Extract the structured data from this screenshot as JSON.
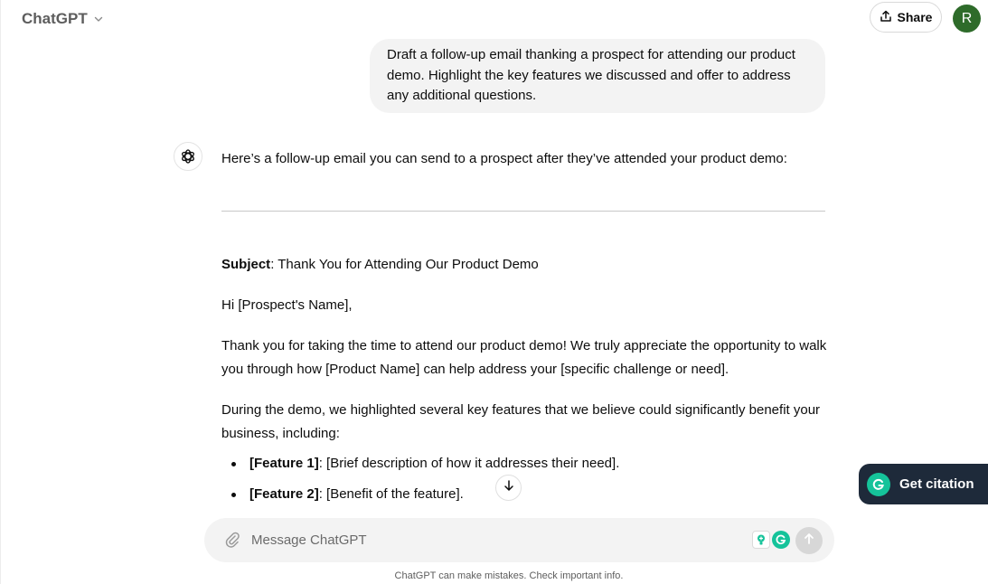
{
  "header": {
    "model_name": "ChatGPT",
    "share_label": "Share",
    "avatar_initial": "R"
  },
  "conversation": {
    "user_message": "Draft a follow-up email thanking a prospect for attending our product demo. Highlight the key features we discussed and offer to address any additional questions.",
    "assistant_intro": "Here’s a follow-up email you can send to a prospect after they’ve attended your product demo:",
    "subject_label": "Subject",
    "subject_text": ": Thank You for Attending Our Product Demo",
    "greeting": "Hi [Prospect's Name],",
    "paragraph_1": "Thank you for taking the time to attend our product demo! We truly appreciate the opportunity to walk you through how [Product Name] can help address your [specific challenge or need].",
    "paragraph_2": "During the demo, we highlighted several key features that we believe could significantly benefit your business, including:",
    "features": [
      {
        "name": "[Feature 1]",
        "desc": ": [Brief description of how it addresses their need]."
      },
      {
        "name": "[Feature 2]",
        "desc": ": [Benefit of the feature]."
      }
    ]
  },
  "grammarly": {
    "citation_label": "Get citation",
    "brand_color": "#15c39a"
  },
  "composer": {
    "placeholder": "Message ChatGPT"
  },
  "footer": {
    "disclaimer": "ChatGPT can make mistakes. Check important info."
  },
  "icons": [
    "chevron-down-icon",
    "share-icon",
    "openai-logo-icon",
    "arrow-down-icon",
    "grammarly-logo-icon",
    "paperclip-icon",
    "lightbulb-icon",
    "send-arrow-icon"
  ],
  "colors": {
    "avatar_bg": "#2e6b2a",
    "bubble_bg": "#f3f3f3",
    "citation_bg": "#1e2a3a"
  }
}
